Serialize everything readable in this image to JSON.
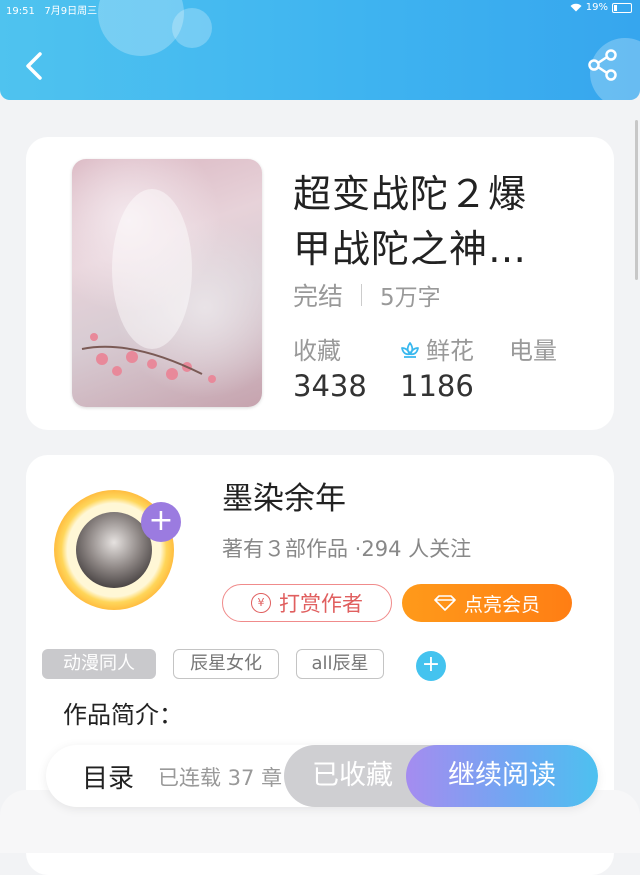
{
  "status_bar": {
    "time": "19:51",
    "date": "7月9日周三",
    "battery": "19%"
  },
  "header": {
    "back_icon": "chevron-left-icon",
    "share_icon": "share-icon",
    "color": "#3fb4f0"
  },
  "book": {
    "title": "超变战陀２爆\n甲战陀之神…",
    "status": "完结",
    "word_count": "5万字",
    "stats": [
      {
        "label": "收藏",
        "value": "3438"
      },
      {
        "label": "鲜花",
        "value": "1186"
      },
      {
        "label": "电量",
        "value": ""
      }
    ]
  },
  "author": {
    "name": "墨染余年",
    "info": "著有３部作品 ·294 人关注",
    "reward_label": "打赏作者",
    "vip_label": "点亮会员"
  },
  "tags": [
    "动漫同人",
    "辰星女化",
    "all辰星"
  ],
  "intro_label": "作品简介：",
  "bottom_bar": {
    "toc_label": "目录",
    "chapters": "已连载 37 章",
    "collected_label": "已收藏",
    "read_label": "继续阅读"
  }
}
